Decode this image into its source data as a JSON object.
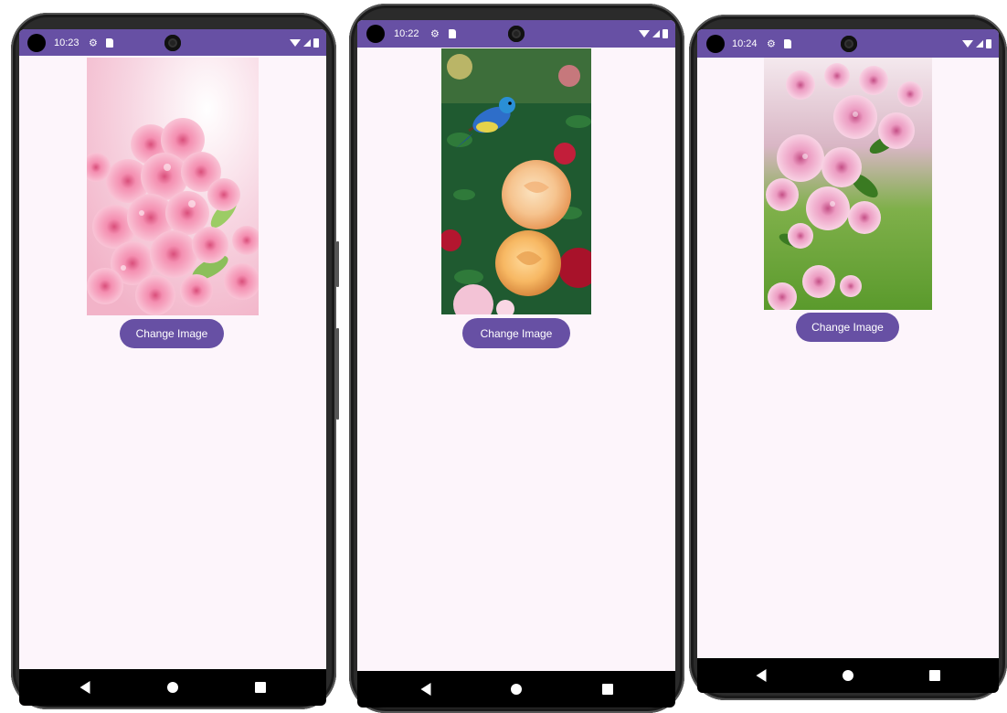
{
  "phones": [
    {
      "status": {
        "time": "10:23"
      },
      "button_label": "Change Image",
      "image": {
        "subject": "pink cherry blossoms",
        "colors": [
          "#f7c9d8",
          "#e8829f",
          "#ffffff",
          "#8bbf5a"
        ]
      }
    },
    {
      "status": {
        "time": "10:22"
      },
      "button_label": "Change Image",
      "image": {
        "subject": "blue bird on peach roses",
        "colors": [
          "#1e5a34",
          "#f6c48f",
          "#2e6ec9",
          "#c21e3a"
        ]
      }
    },
    {
      "status": {
        "time": "10:24"
      },
      "button_label": "Change Image",
      "image": {
        "subject": "pink crabapple blossoms on green",
        "colors": [
          "#6aa832",
          "#e79bc0",
          "#ffffff",
          "#3a7a22"
        ]
      }
    }
  ],
  "theme": {
    "primary": "#6750a4",
    "background": "#fdf5fb",
    "navbar": "#000000"
  }
}
